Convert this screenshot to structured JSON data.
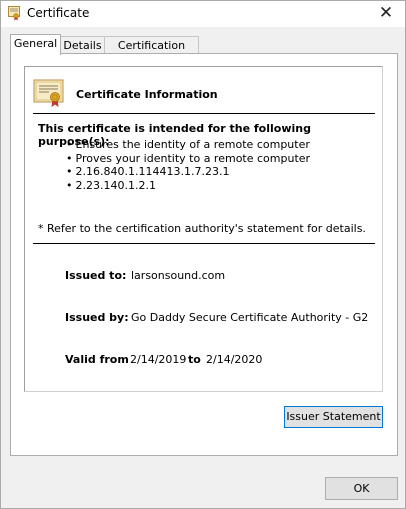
{
  "window": {
    "title": "Certificate",
    "close_glyph": "✕"
  },
  "tabs": [
    {
      "label": "General",
      "active": true
    },
    {
      "label": "Details",
      "active": false
    },
    {
      "label": "Certification Path",
      "active": false
    }
  ],
  "general": {
    "info_title": "Certificate Information",
    "purpose_title": "This certificate is intended for the following purpose(s):",
    "purposes": [
      "Ensures the identity of a remote computer",
      "Proves your identity to a remote computer",
      "2.16.840.1.114413.1.7.23.1",
      "2.23.140.1.2.1"
    ],
    "refer_note": "* Refer to the certification authority's statement for details.",
    "issued_to_label": "Issued to:",
    "issued_to_value": "larsonsound.com",
    "issued_by_label": "Issued by:",
    "issued_by_value": "Go Daddy Secure Certificate Authority - G2",
    "valid_from_label": "Valid from",
    "valid_from_value": "2/14/2019",
    "valid_to_label": "to",
    "valid_to_value": "2/14/2020",
    "issuer_statement_label": "Issuer Statement"
  },
  "footer": {
    "ok_label": "OK"
  },
  "colors": {
    "accent": "#0078d7",
    "button": "#e1e1e1",
    "window_bg": "#f0f0f0"
  },
  "icons": {
    "title": "certificate-icon",
    "info": "certificate-icon",
    "close": "close-icon"
  }
}
